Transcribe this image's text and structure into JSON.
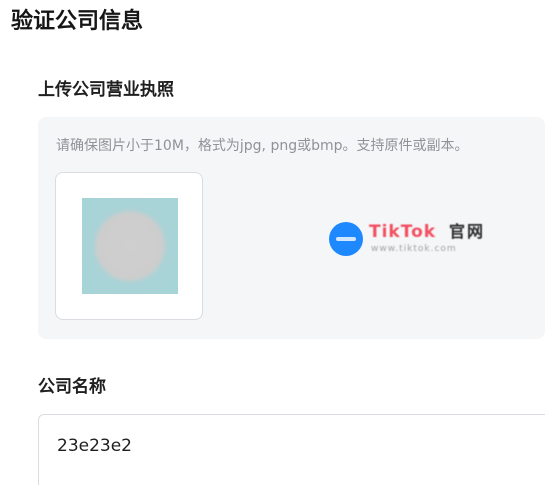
{
  "page": {
    "title": "验证公司信息"
  },
  "license_upload": {
    "title": "上传公司营业执照",
    "hint": "请确保图片小于10M，格式为jpg, png或bmp。支持原件或副本。",
    "preview_image": "uploaded-license-thumbnail",
    "watermark_text": "TikTok",
    "watermark_text_dark": "官网",
    "watermark_subtext": "www.tiktok.com"
  },
  "company_name": {
    "label": "公司名称",
    "value": "23e23e2"
  },
  "colors": {
    "panel_background": "#f5f6f8",
    "border": "#d9dce1",
    "hint_text": "#8f9298",
    "watermark_blue": "#1e88ff",
    "watermark_red": "#f24f5f"
  }
}
